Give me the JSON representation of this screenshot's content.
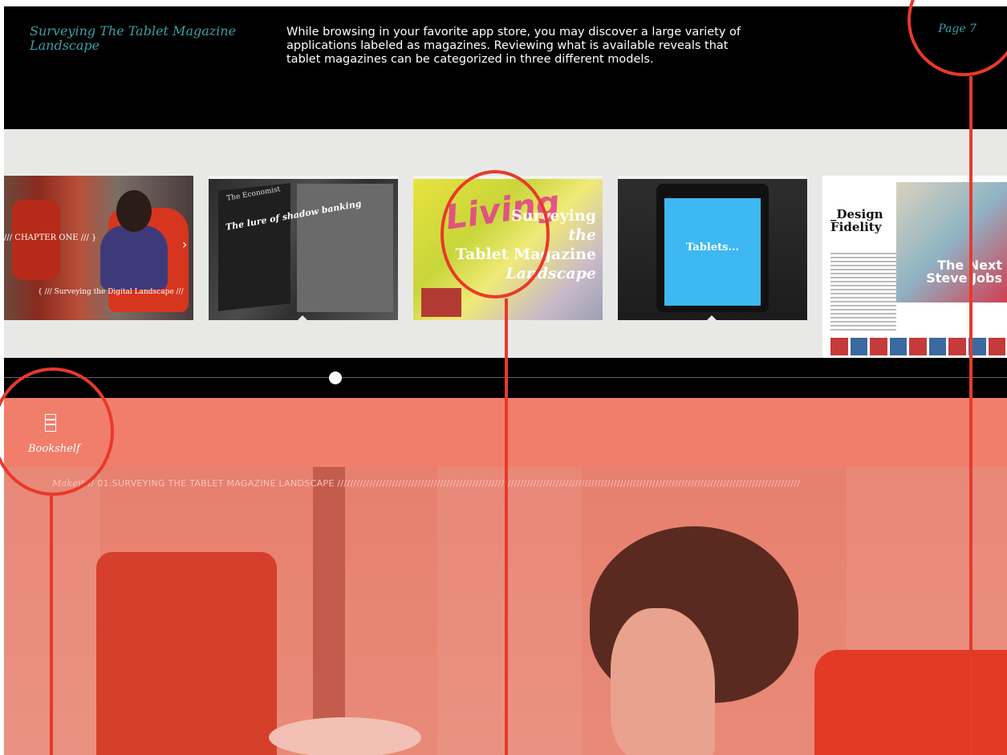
{
  "header": {
    "title": "Surveying The Tablet Magazine Landscape",
    "description": "While browsing in your favorite app store, you may discover a large variety of applications labeled as magazines. Reviewing what is available reveals that tablet magazines can be categorized in three different models.",
    "page_label": "Page 7"
  },
  "thumbnails": [
    {
      "line1": "/// CHAPTER ONE /// }",
      "line2": "{ /// Surveying the Digital Landscape ///"
    },
    {
      "masthead": "The Economist",
      "headline": "The lure of shadow banking"
    },
    {
      "overlay": "Living",
      "title_lines": [
        "Surveying",
        "the",
        "Tablet Magazine",
        "Landscape"
      ]
    },
    {
      "screen_text": "Tablets..."
    },
    {
      "heading_line1": "_Design",
      "heading_line2": "Fidelity",
      "cover_text": "The Next Steve Jobs"
    }
  ],
  "timeline": {
    "position": 0.33
  },
  "nav": {
    "bookshelf_label": "Bookshelf"
  },
  "breadcrumb": {
    "brand": "Makeit",
    "path": " // 01.SURVEYING THE TABLET MAGAZINE LANDSCAPE ////////////////////////////////////////////////////////////////////////////////////////////////////////////////////////////////////////////////"
  },
  "colors": {
    "accent": "#3aa0a4",
    "nav": "#f17e6a",
    "annotation": "#e8392b"
  }
}
